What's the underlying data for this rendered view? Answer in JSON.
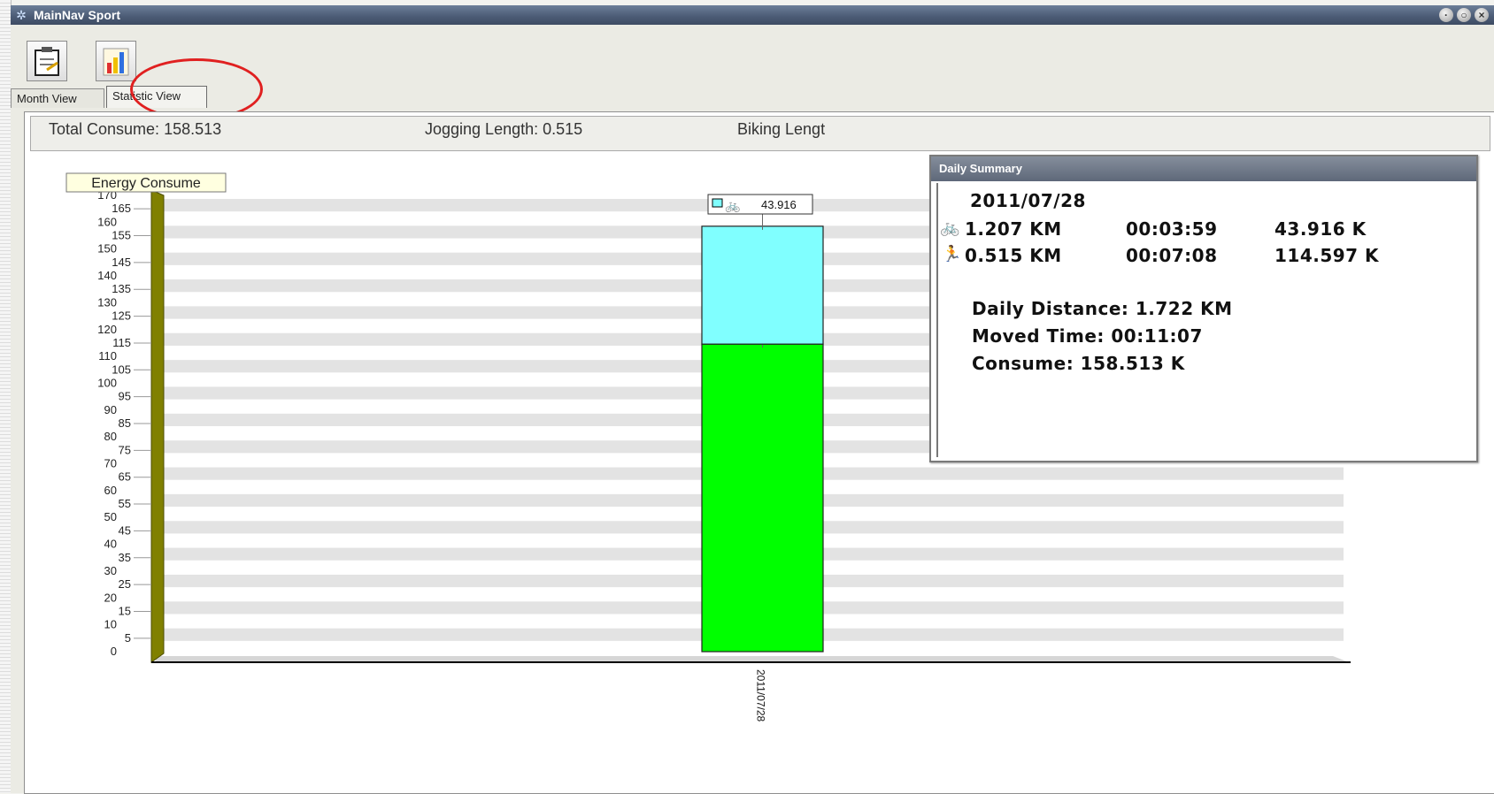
{
  "window": {
    "title": "MainNav Sport",
    "app_icon": "star-icon",
    "controls": [
      "minimize-icon",
      "maximize-icon",
      "close-icon"
    ]
  },
  "toolbar": {
    "buttons": [
      {
        "name": "calendar-clipboard-icon"
      },
      {
        "name": "chart-statistics-icon"
      }
    ]
  },
  "tabs": [
    {
      "label": "Month View",
      "active": false
    },
    {
      "label": "Statistic View",
      "active": true
    }
  ],
  "stats": {
    "total_consume_label": "Total Consume:",
    "total_consume_value": "158.513",
    "jogging_label": "Jogging Length:",
    "jogging_value": "0.515",
    "biking_label": "Biking Lengt"
  },
  "chart_data": {
    "type": "bar",
    "stacked": true,
    "title": "Energy Consume",
    "ylim": [
      0,
      170
    ],
    "y_ticks_left": [
      "170",
      "160",
      "150",
      "140",
      "130",
      "120",
      "110",
      "100",
      "90",
      "80",
      "70",
      "60",
      "50",
      "40",
      "30",
      "20",
      "10",
      "0"
    ],
    "y_ticks_right": [
      "165",
      "155",
      "145",
      "135",
      "125",
      "115",
      "105",
      "95",
      "85",
      "75",
      "65",
      "55",
      "45",
      "35",
      "25",
      "15",
      "5"
    ],
    "categories": [
      "2011/07/28"
    ],
    "series": [
      {
        "icon": "jogging-icon",
        "color": "#00ff00",
        "values": [
          114.597
        ],
        "label": "114.597"
      },
      {
        "icon": "biking-icon",
        "color": "#80ffff",
        "values": [
          43.916
        ],
        "label": "43.916"
      }
    ],
    "grid": true,
    "axis_color": "#808000"
  },
  "summary": {
    "title": "Daily Summary",
    "date": "2011/07/28",
    "rows": [
      {
        "icon": "biking-icon",
        "distance": "1.207 KM",
        "time": "00:03:59",
        "consume": "43.916 K"
      },
      {
        "icon": "jogging-icon",
        "distance": "0.515 KM",
        "time": "00:07:08",
        "consume": "114.597 K"
      }
    ],
    "daily_distance": "Daily Distance:  1.722 KM",
    "moved_time": "Moved Time:  00:11:07",
    "consume": "Consume:  158.513 K"
  }
}
